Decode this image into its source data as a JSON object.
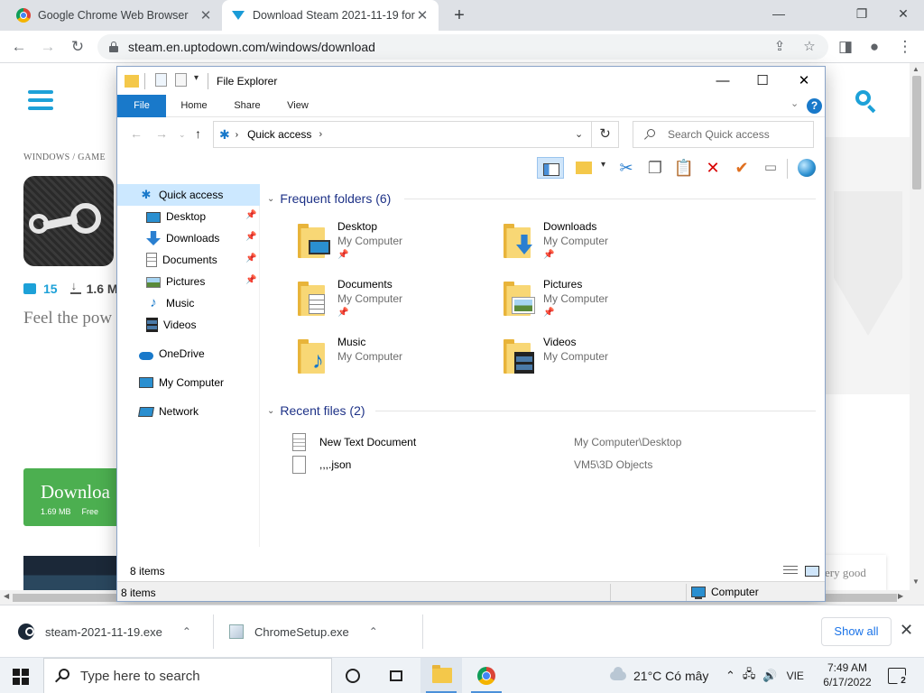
{
  "browser": {
    "tabs": [
      {
        "title": "Google Chrome Web Browser",
        "icon": "chrome-icon"
      },
      {
        "title": "Download Steam 2021-11-19 for",
        "icon": "uptodown-icon"
      }
    ],
    "new_tab": "+",
    "window_controls": {
      "minimize": "—",
      "restore": "❐",
      "close": "✕"
    },
    "url": "steam.en.uptodown.com/windows/download"
  },
  "page": {
    "breadcrumb": "WINDOWS  /  GAME",
    "comments": "15",
    "downloads": "1.6 M",
    "tagline": "Feel the pow",
    "download_button": {
      "label": "Downloa",
      "size": "1.69 MB",
      "license": "Free"
    },
    "chip_text": "ery good",
    "accent": "#1da1d8",
    "button_color": "#4caf50"
  },
  "explorer": {
    "title": "File Explorer",
    "ribbon_tabs": [
      "File",
      "Home",
      "Share",
      "View"
    ],
    "help": "?",
    "address": {
      "location": "Quick access"
    },
    "search_placeholder": "Search Quick access",
    "nav": [
      {
        "label": "Quick access",
        "icon": "quick-access-star-icon",
        "selected": true
      },
      {
        "label": "Desktop",
        "icon": "desktop-icon",
        "pinned": true
      },
      {
        "label": "Downloads",
        "icon": "downloads-icon",
        "pinned": true
      },
      {
        "label": "Documents",
        "icon": "documents-icon",
        "pinned": true
      },
      {
        "label": "Pictures",
        "icon": "pictures-icon",
        "pinned": true
      },
      {
        "label": "Music",
        "icon": "music-icon"
      },
      {
        "label": "Videos",
        "icon": "videos-icon"
      },
      {
        "label": "OneDrive",
        "icon": "onedrive-icon"
      },
      {
        "label": "My Computer",
        "icon": "computer-icon"
      },
      {
        "label": "Network",
        "icon": "network-icon"
      }
    ],
    "frequent_header": "Frequent folders (6)",
    "frequent": [
      {
        "name": "Desktop",
        "location": "My Computer",
        "pinned": true
      },
      {
        "name": "Downloads",
        "location": "My Computer",
        "pinned": true
      },
      {
        "name": "Documents",
        "location": "My Computer",
        "pinned": true
      },
      {
        "name": "Pictures",
        "location": "My Computer",
        "pinned": true
      },
      {
        "name": "Music",
        "location": "My Computer"
      },
      {
        "name": "Videos",
        "location": "My Computer"
      }
    ],
    "recent_header": "Recent files (2)",
    "recent": [
      {
        "name": "New Text Document",
        "path": "My Computer\\Desktop"
      },
      {
        "name": ",,,.json",
        "path": "VM5\\3D Objects"
      }
    ],
    "status_items": "8 items",
    "status_items_bottom": "8 items",
    "status_location": "Computer",
    "accent": "#1979ca"
  },
  "downloads_bar": {
    "items": [
      {
        "name": "steam-2021-11-19.exe"
      },
      {
        "name": "ChromeSetup.exe"
      }
    ],
    "show_all": "Show all",
    "close": "✕"
  },
  "taskbar": {
    "search_placeholder": "Type here to search",
    "weather": "21°C  Có mây",
    "language": "VIE",
    "time": "7:49 AM",
    "date": "6/17/2022",
    "notifications": "2"
  }
}
